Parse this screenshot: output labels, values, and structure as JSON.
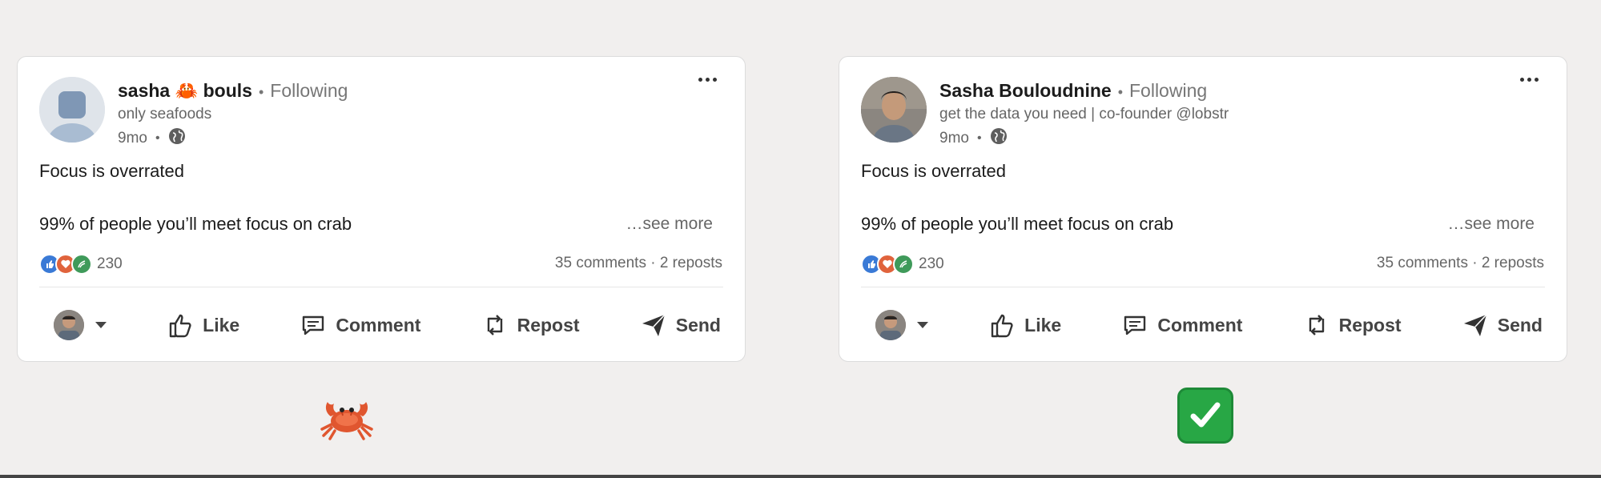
{
  "posts": [
    {
      "author": "sasha 🦀 bouls",
      "following": "Following",
      "headline": "only seafoods",
      "age": "9mo",
      "avatar_icon": "default-avatar-icon",
      "body_line1": "Focus is overrated",
      "body_line2": "99% of people you’ll meet focus on crab",
      "see_more": "…see more",
      "reaction_count": "230",
      "stats": "35 comments · 2 reposts",
      "actions": {
        "like": "Like",
        "comment": "Comment",
        "repost": "Repost",
        "send": "Send"
      }
    },
    {
      "author": "Sasha Bouloudnine",
      "following": "Following",
      "headline": "get the data you need | co-founder @lobstr",
      "age": "9mo",
      "avatar_icon": "profile-photo-avatar",
      "body_line1": "Focus is overrated",
      "body_line2": "99% of people you’ll meet focus on crab",
      "see_more": "…see more",
      "reaction_count": "230",
      "stats": "35 comments · 2 reposts",
      "actions": {
        "like": "Like",
        "comment": "Comment",
        "repost": "Repost",
        "send": "Send"
      }
    }
  ],
  "badges": [
    {
      "icon": "crab-emoji-icon",
      "glyph": "🦀"
    },
    {
      "icon": "check-mark-button-icon",
      "glyph": "✅"
    }
  ],
  "colors": {
    "background": "#f1efee",
    "card": "#ffffff",
    "like_reaction": "#3a7ad6",
    "love_reaction": "#e0633c",
    "support_reaction": "#3f9a5a",
    "check_green": "#28a745"
  }
}
